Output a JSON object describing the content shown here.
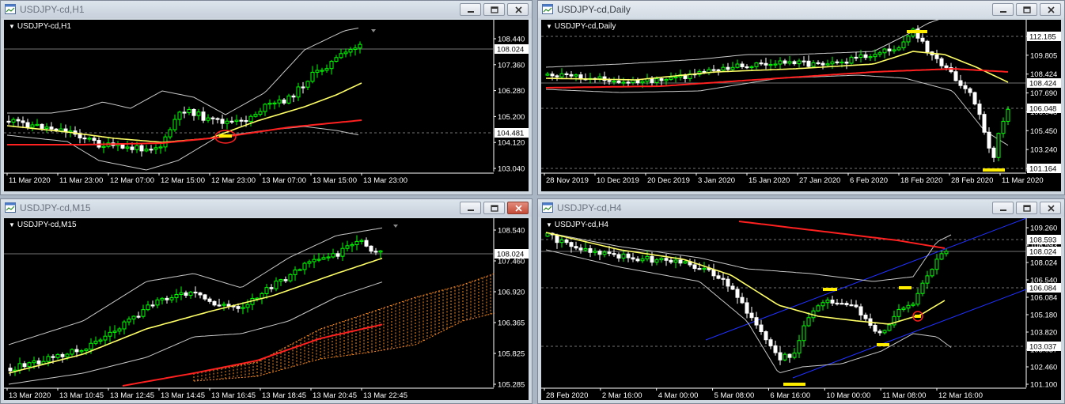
{
  "windows": [
    {
      "title": "USDJPY-cd,H1",
      "symbol_label": "USDJPY-cd,H1",
      "price_ticks": [
        "108.440",
        "107.360",
        "106.280",
        "105.200",
        "104.120",
        "103.040"
      ],
      "price_boxes": [
        {
          "label": "108.024",
          "style": "current"
        },
        {
          "label": "104.481",
          "style": "level"
        }
      ],
      "time_ticks": [
        "11 Mar 2020",
        "11 Mar 23:00",
        "12 Mar 07:00",
        "12 Mar 15:00",
        "12 Mar 23:00",
        "13 Mar 07:00",
        "13 Mar 15:00",
        "13 Mar 23:00"
      ]
    },
    {
      "title": "USDJPY-cd,Daily",
      "symbol_label": "USDJPY-cd,Daily",
      "price_ticks": [
        "112.185",
        "109.805",
        "108.424",
        "107.690",
        "106.048",
        "105.450",
        "103.240",
        "101.164"
      ],
      "price_boxes": [
        {
          "label": "112.185",
          "style": "level"
        },
        {
          "label": "108.424",
          "style": "current"
        },
        {
          "label": "106.048",
          "style": "level"
        },
        {
          "label": "101.164",
          "style": "level"
        }
      ],
      "time_ticks": [
        "28 Nov 2019",
        "10 Dec 2019",
        "20 Dec 2019",
        "3 Jan 2020",
        "15 Jan 2020",
        "27 Jan 2020",
        "6 Feb 2020",
        "18 Feb 2020",
        "28 Feb 2020",
        "11 Mar 2020"
      ]
    },
    {
      "title": "USDJPY-cd,M15",
      "symbol_label": "USDJPY-cd,M15",
      "price_ticks": [
        "108.540",
        "107.460",
        "106.920",
        "106.365",
        "105.825",
        "105.285"
      ],
      "price_boxes": [
        {
          "label": "108.024",
          "style": "current"
        }
      ],
      "time_ticks": [
        "13 Mar 2020",
        "13 Mar 10:45",
        "13 Mar 12:45",
        "13 Mar 14:45",
        "13 Mar 16:45",
        "13 Mar 18:45",
        "13 Mar 20:45",
        "13 Mar 22:45"
      ]
    },
    {
      "title": "USDJPY-cd,H4",
      "symbol_label": "USDJPY-cd,H4",
      "price_ticks": [
        "109.260",
        "108.593",
        "108.024",
        "106.540",
        "106.084",
        "105.180",
        "103.820",
        "103.037",
        "102.460",
        "101.100"
      ],
      "price_boxes": [
        {
          "label": "108.593",
          "style": "level"
        },
        {
          "label": "108.024",
          "style": "current"
        },
        {
          "label": "106.084",
          "style": "level"
        },
        {
          "label": "103.037",
          "style": "level"
        }
      ],
      "time_ticks": [
        "28 Feb 2020",
        "2 Mar 16:00",
        "4 Mar 00:00",
        "5 Mar 08:00",
        "6 Mar 16:00",
        "10 Mar 00:00",
        "11 Mar 08:00",
        "12 Mar 16:00"
      ]
    }
  ],
  "colors": {
    "chart_bg": "#000000",
    "bull_candle": "#00ff00",
    "bear_candle": "#ffffff",
    "bollinger": "#c8c8c8",
    "ma_fast": "#ffff66",
    "ma_slow": "#ff2020",
    "channel": "#2030ff",
    "highlight": "#ffee00",
    "cloud": "#ff8c20"
  },
  "icons": {
    "window": "chart-window-icon",
    "minimize": "minimize-icon",
    "maximize": "maximize-icon",
    "close": "close-icon"
  }
}
